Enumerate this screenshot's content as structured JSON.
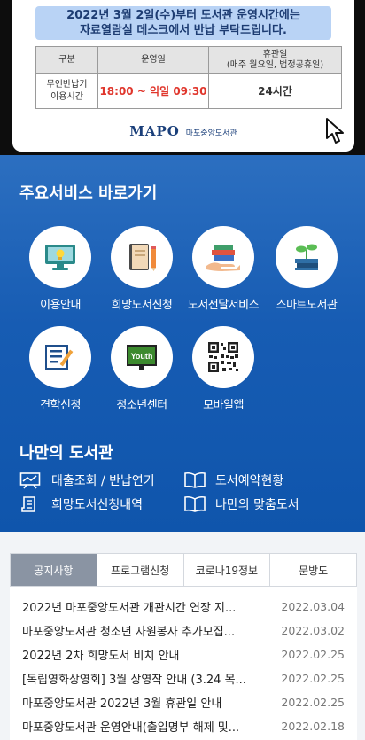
{
  "banner": {
    "notice_line1": "2022년 3월 2일(수)부터 도서관 운영시간에는",
    "notice_line2": "자료열람실 데스크에서 반납 부탁드립니다.",
    "table_head": {
      "col1": "구분",
      "col2": "운영일",
      "col3_line1": "휴관일",
      "col3_line2": "(매주 월요일, 법정공휴일)"
    },
    "table_row": {
      "label_line1": "무인반납기",
      "label_line2": "이용시간",
      "hours": "18:00 ~ 익일 09:30",
      "days": "24시간"
    },
    "logo_mark": "MAPO",
    "logo_text": "마포중앙도서관"
  },
  "services": {
    "title": "주요서비스 바로가기",
    "items": [
      {
        "label": "이용안내",
        "icon": "monitor-lightbulb-icon"
      },
      {
        "label": "희망도서신청",
        "icon": "notebook-pencil-icon"
      },
      {
        "label": "도서전달서비스",
        "icon": "books-hand-icon"
      },
      {
        "label": "스마트도서관",
        "icon": "sprout-books-icon"
      },
      {
        "label": "견학신청",
        "icon": "checklist-pencil-icon"
      },
      {
        "label": "청소년센터",
        "icon": "youth-board-icon"
      },
      {
        "label": "모바일앱",
        "icon": "qr-code-icon"
      }
    ],
    "youth_badge": "Youth"
  },
  "my_library": {
    "title": "나만의 도서관",
    "items": [
      {
        "label": "대출조회 / 반납연기",
        "icon": "chart-board-icon"
      },
      {
        "label": "도서예약현황",
        "icon": "open-book-icon"
      },
      {
        "label": "희망도서신청내역",
        "icon": "document-icon"
      },
      {
        "label": "나만의 맞춤도서",
        "icon": "open-book-icon"
      }
    ]
  },
  "board": {
    "tabs": [
      "공지사항",
      "프로그램신청",
      "코로나19정보",
      "문방도"
    ],
    "notices": [
      {
        "title": "2022년 마포중앙도서관 개관시간 연장 지...",
        "date": "2022.03.04"
      },
      {
        "title": "마포중앙도서관 청소년 자원봉사 추가모집...",
        "date": "2022.03.02"
      },
      {
        "title": "2022년 2차 희망도서 비치 안내",
        "date": "2022.02.25"
      },
      {
        "title": "[독립영화상영회] 3월 상영작 안내 (3.24 목...",
        "date": "2022.02.25"
      },
      {
        "title": "마포중앙도서관 2022년 3월 휴관일 안내",
        "date": "2022.02.25"
      },
      {
        "title": "마포중앙도서관 운영안내(출입명부 해제 및...",
        "date": "2022.02.18"
      }
    ]
  }
}
